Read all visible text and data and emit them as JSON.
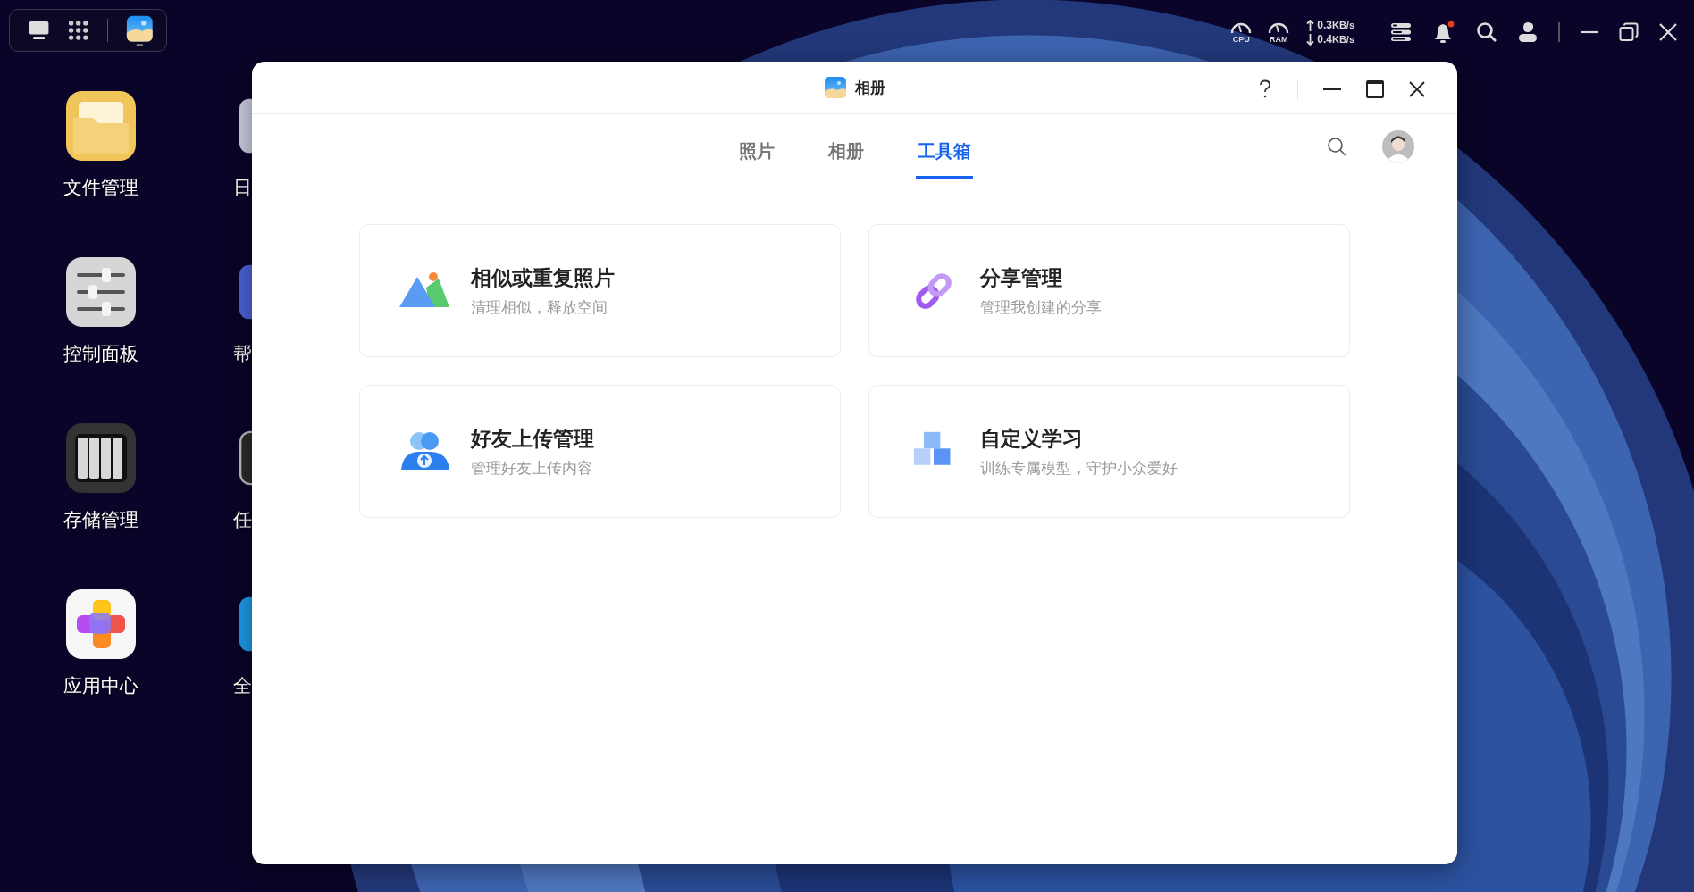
{
  "status_bar": {
    "gauges": [
      {
        "label": "CPU"
      },
      {
        "label": "RAM"
      }
    ],
    "upload": "0.3",
    "upload_unit": "KB/s",
    "download": "0.4",
    "download_unit": "KB/s",
    "notification_unread": true
  },
  "desktop": {
    "icons": [
      {
        "label": "文件管理",
        "kind": "files"
      },
      {
        "label": "控制面板",
        "kind": "control"
      },
      {
        "label": "存储管理",
        "kind": "storage"
      },
      {
        "label": "应用中心",
        "kind": "appstore"
      }
    ],
    "second_column": [
      {
        "label": "日",
        "kind": "calendar"
      },
      {
        "label": "帮",
        "kind": "help"
      },
      {
        "label": "任",
        "kind": "monitor"
      },
      {
        "label": "全",
        "kind": "blue"
      }
    ]
  },
  "window": {
    "title": "相册"
  },
  "tabs": [
    {
      "label": "照片",
      "selected": false
    },
    {
      "label": "相册",
      "selected": false
    },
    {
      "label": "工具箱",
      "selected": true
    }
  ],
  "tools": [
    {
      "kind": "similar",
      "title": "相似或重复照片",
      "subtitle": "清理相似，释放空间"
    },
    {
      "kind": "share",
      "title": "分享管理",
      "subtitle": "管理我创建的分享"
    },
    {
      "kind": "friends",
      "title": "好友上传管理",
      "subtitle": "管理好友上传内容"
    },
    {
      "kind": "learning",
      "title": "自定义学习",
      "subtitle": "训练专属模型，守护小众爱好"
    }
  ]
}
